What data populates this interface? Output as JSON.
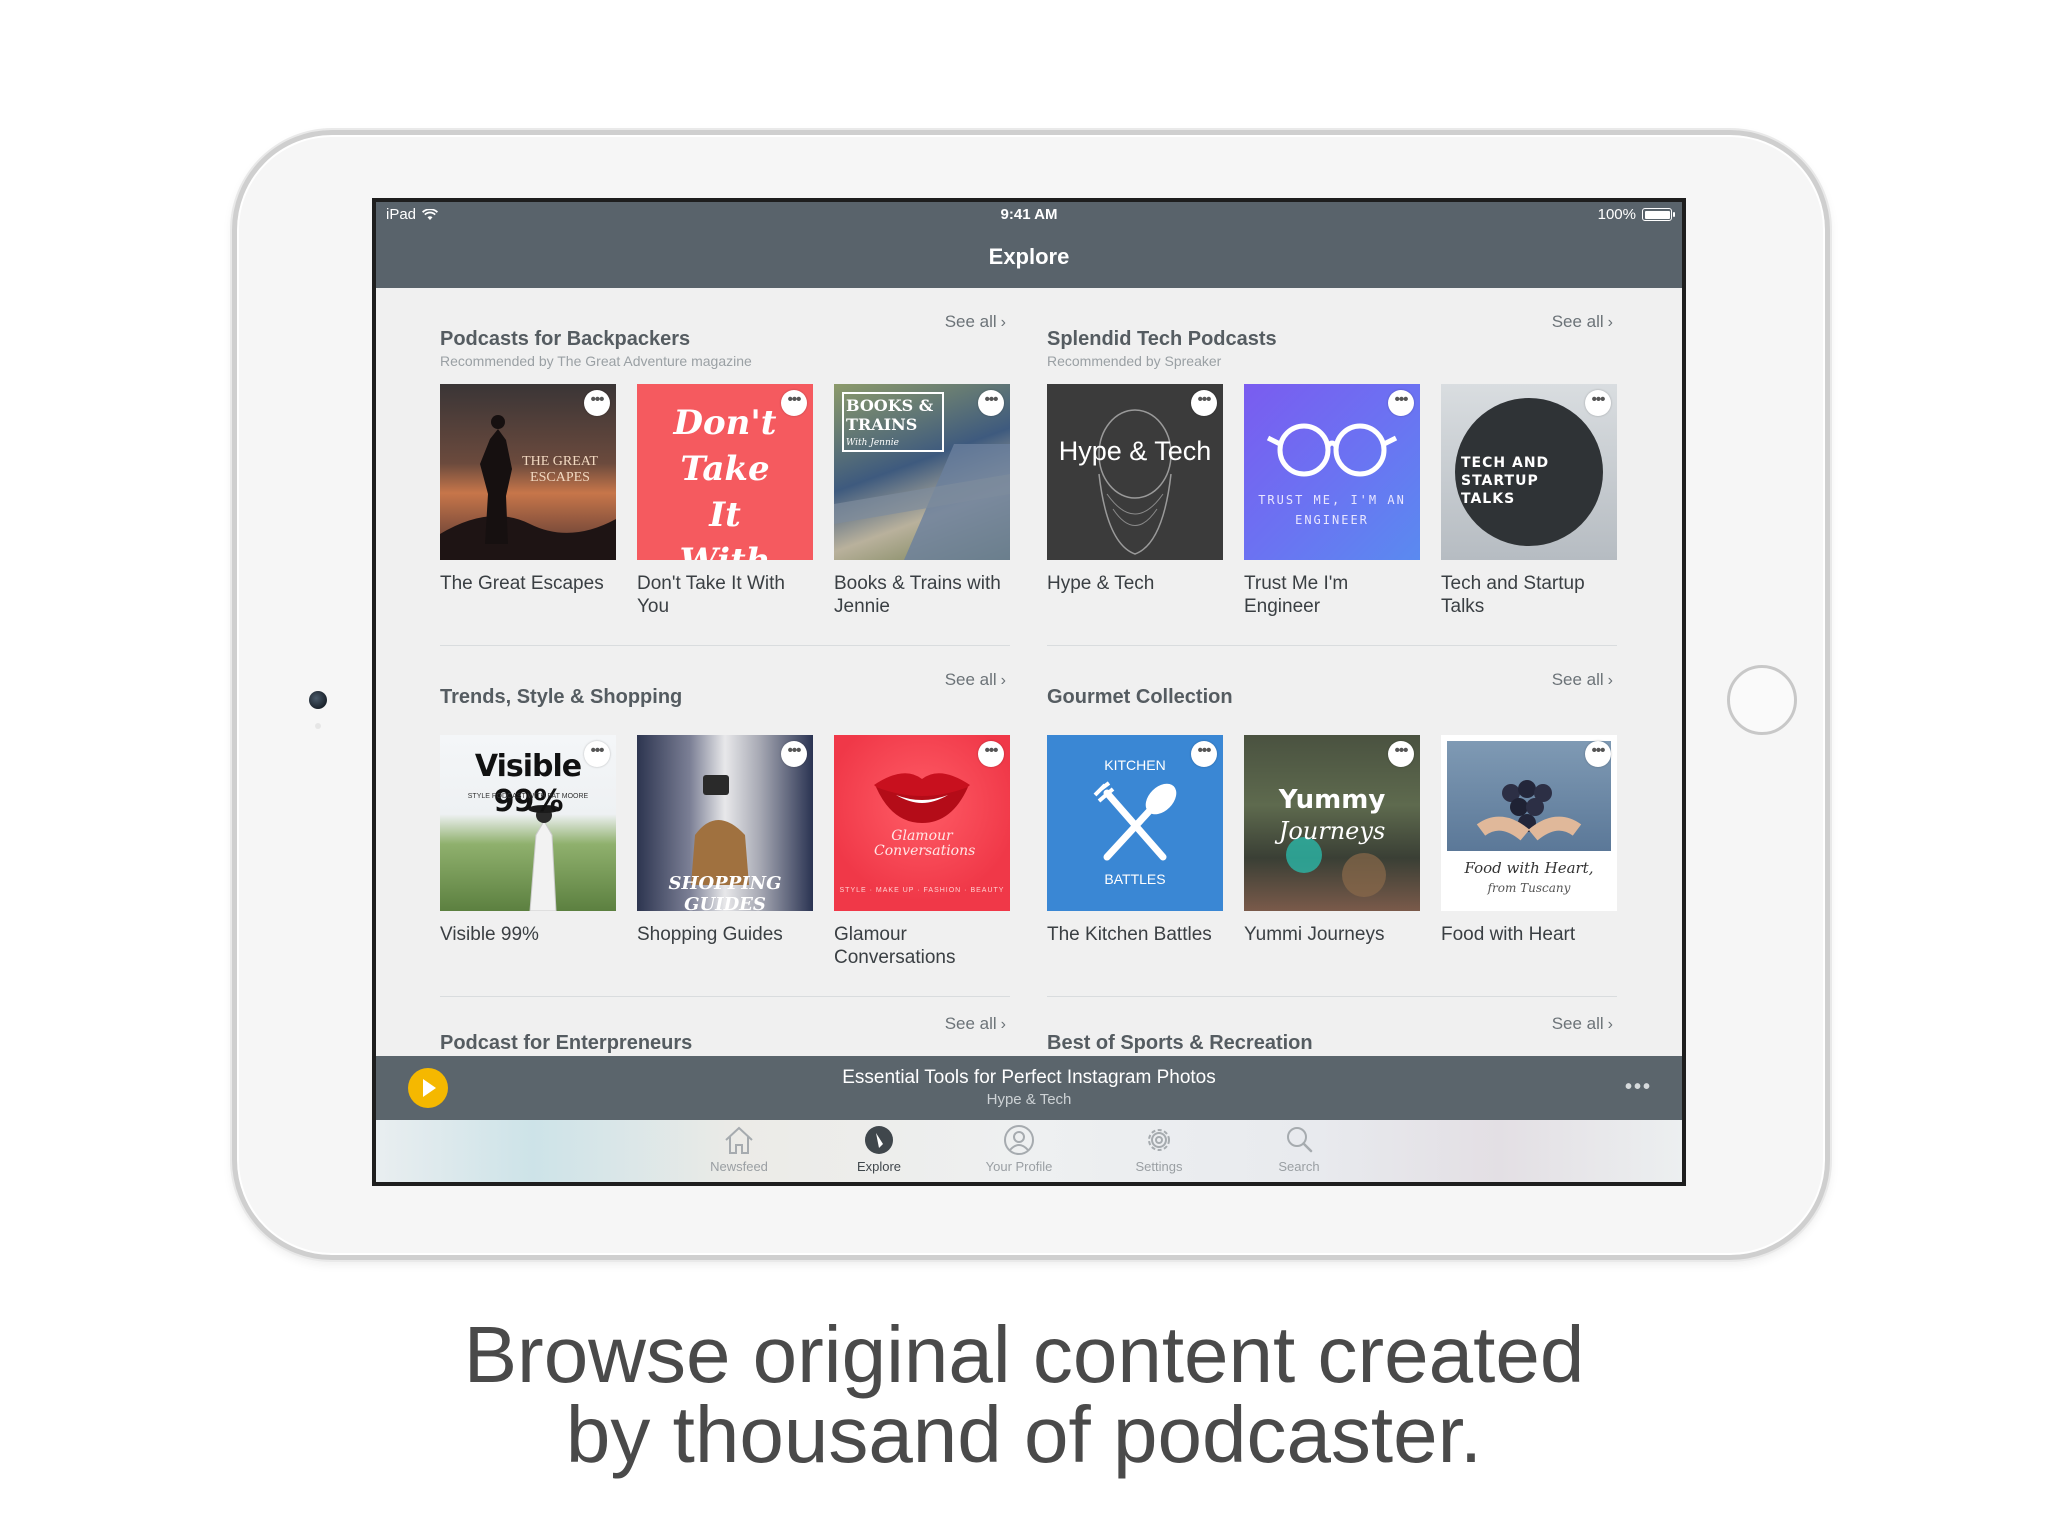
{
  "status_bar": {
    "carrier": "iPad",
    "time": "9:41 AM",
    "battery": "100%"
  },
  "nav": {
    "title": "Explore"
  },
  "sections": [
    {
      "title": "Podcasts for Backpackers",
      "subtitle": "Recommended by The Great Adventure magazine",
      "see_all": "See all",
      "items": [
        {
          "title": "The Great Escapes",
          "cover_text": "THE GREAT ESCAPES"
        },
        {
          "title": "Don't Take It With You",
          "cover_text": "Don't Take It With You"
        },
        {
          "title": "Books & Trains with Jennie",
          "cover_text": "BOOKS & TRAINS",
          "cover_sub": "With Jennie"
        }
      ]
    },
    {
      "title": "Splendid Tech Podcasts",
      "subtitle": "Recommended by Spreaker",
      "see_all": "See all",
      "items": [
        {
          "title": "Hype & Tech",
          "cover_text": "Hype & Tech"
        },
        {
          "title": "Trust Me I'm Engineer",
          "cover_text": "TRUST ME, I'M AN ENGINEER"
        },
        {
          "title": "Tech and Startup Talks",
          "cover_text": "TECH AND STARTUP TALKS"
        }
      ]
    },
    {
      "title": "Trends, Style & Shopping",
      "subtitle": "",
      "see_all": "See all",
      "items": [
        {
          "title": "Visible 99%",
          "cover_text": "Visible 99%",
          "cover_sub": "STYLE PODCAST WITH PAT MOORE"
        },
        {
          "title": "Shopping Guides",
          "cover_text": "SHOPPING GUIDES"
        },
        {
          "title": "Glamour Conversations",
          "cover_text": "Glamour Conversations",
          "cover_sub": "STYLE · MAKE UP · FASHION · BEAUTY"
        }
      ]
    },
    {
      "title": "Gourmet Collection",
      "subtitle": "",
      "see_all": "See all",
      "items": [
        {
          "title": "The Kitchen Battles",
          "cover_text": "KITCHEN",
          "cover_sub": "BATTLES"
        },
        {
          "title": "Yummi Journeys",
          "cover_text": "Yummy",
          "cover_sub": "Journeys"
        },
        {
          "title": "Food with Heart",
          "cover_text": "Food with Heart,",
          "cover_sub": "from Tuscany"
        }
      ]
    },
    {
      "title": "Podcast for Enterpreneurs",
      "see_all": "See all"
    },
    {
      "title": "Best of Sports & Recreation",
      "see_all": "See all"
    }
  ],
  "player": {
    "title": "Essential Tools for Perfect Instagram Photos",
    "subtitle": "Hype & Tech",
    "more": "•••"
  },
  "tabs": [
    {
      "label": "Newsfeed",
      "icon": "house-icon"
    },
    {
      "label": "Explore",
      "icon": "compass-icon",
      "active": true
    },
    {
      "label": "Your Profile",
      "icon": "profile-icon"
    },
    {
      "label": "Settings",
      "icon": "gear-icon"
    },
    {
      "label": "Search",
      "icon": "search-icon"
    }
  ],
  "caption": {
    "line1": "Browse original content created",
    "line2": "by thousand of podcaster."
  },
  "colors": {
    "nav_bg": "#59636b",
    "accent_play": "#f5b800",
    "caption": "#4a4a4a"
  }
}
